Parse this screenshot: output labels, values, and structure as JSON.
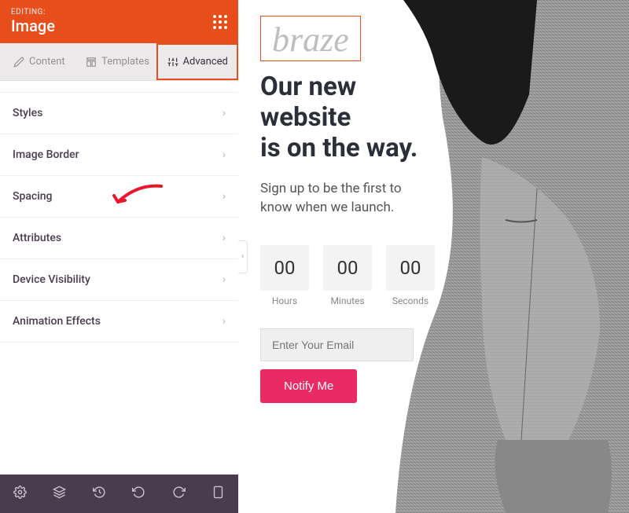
{
  "header": {
    "label": "EDITING:",
    "title": "Image"
  },
  "tabs": [
    {
      "label": "Content",
      "icon": "pencil"
    },
    {
      "label": "Templates",
      "icon": "template"
    },
    {
      "label": "Advanced",
      "icon": "sliders"
    }
  ],
  "sections": [
    "Styles",
    "Image Border",
    "Spacing",
    "Attributes",
    "Device Visibility",
    "Animation Effects"
  ],
  "preview": {
    "logo": "braze",
    "headline_l1": "Our new",
    "headline_l2": "website",
    "headline_l3": "is on the way.",
    "subtext_l1": "Sign up to be the first to",
    "subtext_l2": "know when we launch.",
    "countdown": [
      {
        "value": "00",
        "label": "Hours"
      },
      {
        "value": "00",
        "label": "Minutes"
      },
      {
        "value": "00",
        "label": "Seconds"
      }
    ],
    "email_placeholder": "Enter Your Email",
    "button": "Notify Me"
  }
}
